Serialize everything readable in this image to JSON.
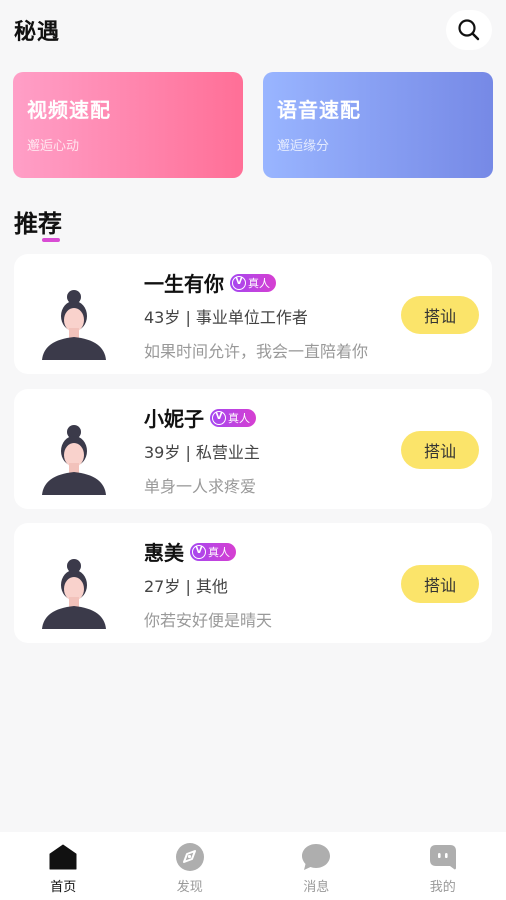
{
  "header": {
    "title": "秘遇",
    "search_icon": "search-icon"
  },
  "match_cards": [
    {
      "title": "视频速配",
      "subtitle": "邂逅心动",
      "color_start": "#ff9fc7",
      "color_end": "#ff6f97"
    },
    {
      "title": "语音速配",
      "subtitle": "邂逅缘分",
      "color_start": "#99b5ff",
      "color_end": "#7689e6"
    }
  ],
  "section": {
    "title": "推荐"
  },
  "users": [
    {
      "name": "一生有你",
      "badge": "真人",
      "meta": "43岁 | 事业单位工作者",
      "bio": "如果时间允许，我会一直陪着你",
      "action": "搭讪"
    },
    {
      "name": "小妮子",
      "badge": "真人",
      "meta": "39岁 | 私营业主",
      "bio": "单身一人求疼爱",
      "action": "搭讪"
    },
    {
      "name": "惠美",
      "badge": "真人",
      "meta": "27岁 | 其他",
      "bio": "你若安好便是晴天",
      "action": "搭讪"
    }
  ],
  "nav": [
    {
      "label": "首页",
      "icon": "home-icon",
      "active": true
    },
    {
      "label": "发现",
      "icon": "compass-icon",
      "active": false
    },
    {
      "label": "消息",
      "icon": "message-icon",
      "active": false
    },
    {
      "label": "我的",
      "icon": "profile-icon",
      "active": false
    }
  ],
  "colors": {
    "accent": "#d94cd4",
    "chat_button": "#fbe46a",
    "badge": "#b843e6"
  }
}
